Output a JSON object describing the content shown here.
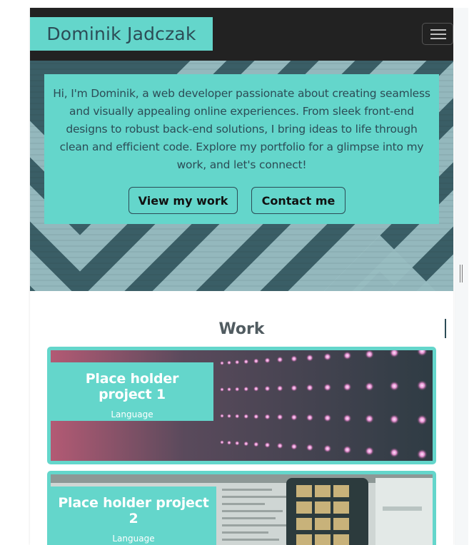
{
  "navbar": {
    "brand": "Dominik Jadczak",
    "toggler_icon": "hamburger-menu-icon"
  },
  "hero": {
    "intro": "Hi, I'm Dominik, a web developer passionate about creating seamless and visually appealing online experiences. From sleek front-end designs to robust back-end solutions, I bring ideas to life through clean and efficient code. Explore my portfolio for a glimpse into my work, and let's connect!",
    "view_work_label": "View my work",
    "contact_label": "Contact me"
  },
  "work": {
    "title": "Work",
    "projects": [
      {
        "title": "Place holder project 1",
        "language": "Language"
      },
      {
        "title": "Place holder project 2",
        "language": "Language"
      }
    ]
  },
  "colors": {
    "accent": "#64d6cb",
    "navbar_bg": "#222222",
    "dark_text": "#2c4c56"
  }
}
